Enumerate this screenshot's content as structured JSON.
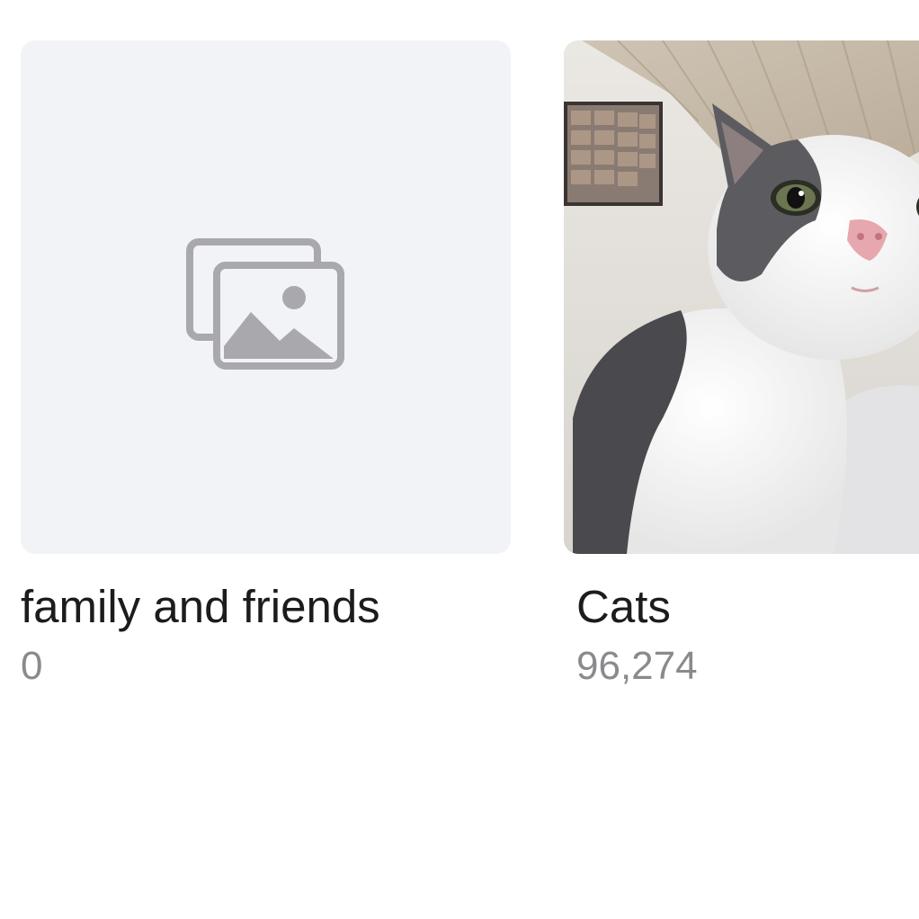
{
  "albums": [
    {
      "title": "family and friends",
      "count": "0",
      "thumbnail": "placeholder-photos-icon"
    },
    {
      "title": "Cats",
      "count": "96,274",
      "thumbnail": "cat-photo"
    }
  ],
  "colors": {
    "placeholder_bg": "#f2f3f7",
    "placeholder_icon": "#a9a9ad",
    "title_text": "#1c1c1e",
    "count_text": "#8a8a8e"
  }
}
